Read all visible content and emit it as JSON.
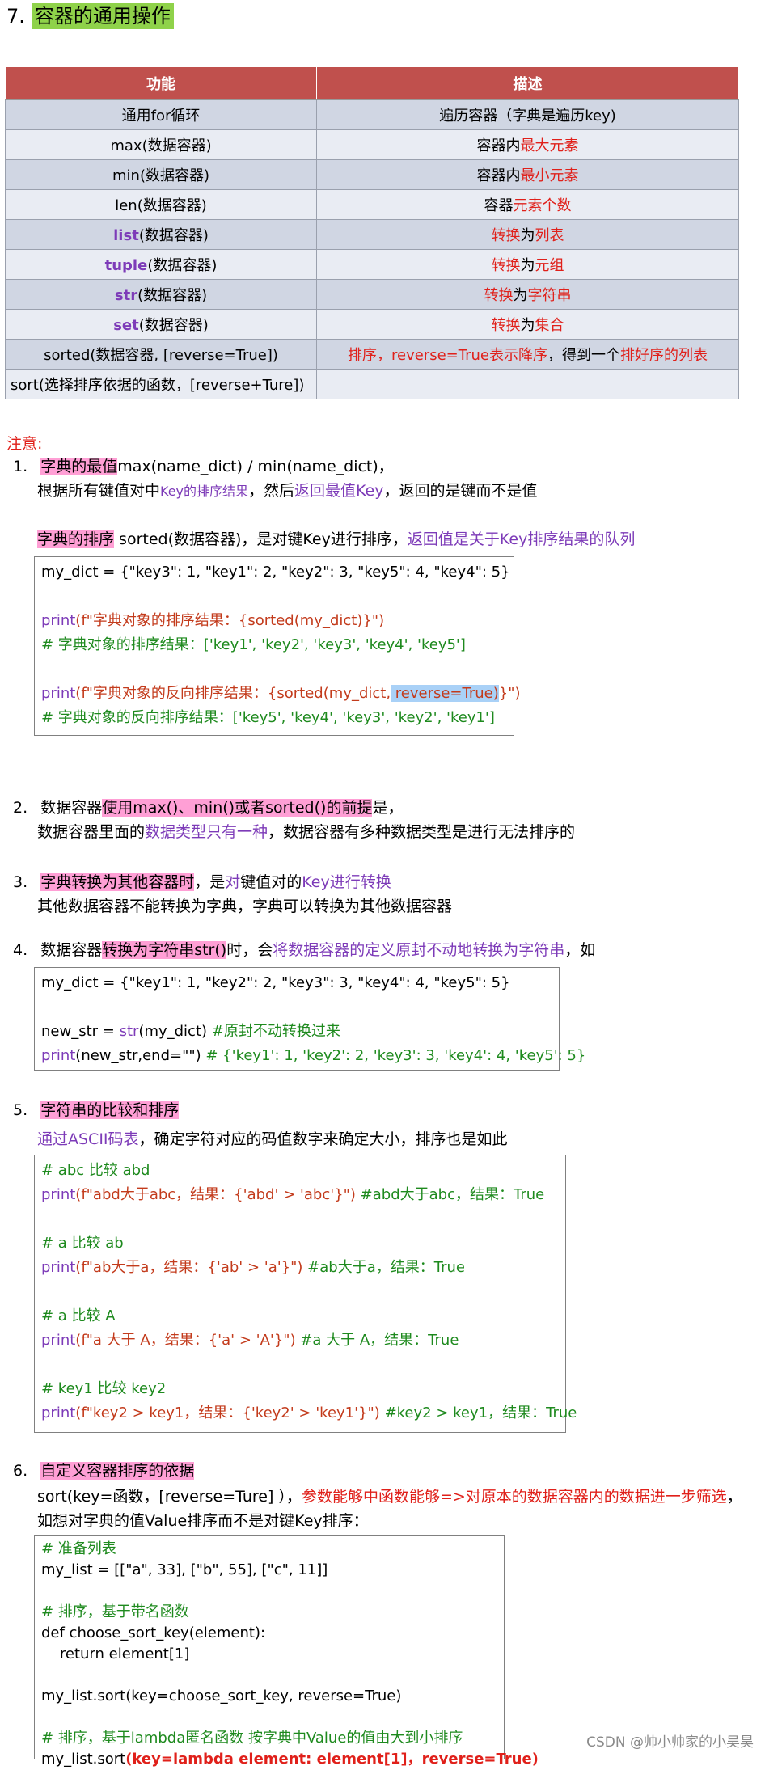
{
  "heading": {
    "number": "7.",
    "title": "容器的通用操作"
  },
  "table": {
    "headers": [
      "功能",
      "描述"
    ],
    "rows": [
      {
        "func": "通用for循环",
        "desc": "遍历容器（字典是遍历key)"
      },
      {
        "func": "max(数据容器)",
        "desc_a": "容器内",
        "desc_b": "最大元素"
      },
      {
        "func": "min(数据容器)",
        "desc_a": "容器内",
        "desc_b": "最小元素"
      },
      {
        "func": "len(数据容器)",
        "desc_a": "容器",
        "desc_b": "元素个数"
      },
      {
        "func_kw": "list",
        "func_rest": "(数据容器)",
        "desc_a": "转换",
        "desc_b": "为",
        "desc_c": "列表"
      },
      {
        "func_kw": "tuple",
        "func_rest": "(数据容器)",
        "desc_a": "转换",
        "desc_b": "为",
        "desc_c": "元组"
      },
      {
        "func_kw": "str",
        "func_rest": "(数据容器)",
        "desc_a": "转换",
        "desc_b": "为",
        "desc_c": "字符串"
      },
      {
        "func_kw": "set",
        "func_rest": "(数据容器)",
        "desc_a": "转换",
        "desc_b": "为",
        "desc_c": "集合"
      },
      {
        "func": "sorted(数据容器, [reverse=True])",
        "desc_a": "排序，reverse=True表示降序",
        "desc_b": "，得到一个",
        "desc_c": "排好序的列表"
      },
      {
        "func": "sort(选择排序依据的函数，[reverse+Ture])",
        "desc": ""
      }
    ]
  },
  "notes": {
    "label": "注意:",
    "n1": {
      "num": "1.",
      "hl": "字典的最值",
      "rest": "max(name_dict) / min(name_dict)，",
      "line2_a": "根据所有键值对中",
      "line2_b": "Key的排序结果",
      "line2_c": "，然后",
      "line2_d": "返回最值Key",
      "line2_e": "，返回的是键而不是值",
      "line3_hl": "字典的排序",
      "line3_a": " sorted(数据容器)，是对键Key进行排序，",
      "line3_b": "返回值是关于Key排序结果的队列",
      "code": {
        "l1": "my_dict = {\"key3\": 1, \"key1\": 2, \"key2\": 3, \"key5\": 4, \"key4\": 5}",
        "l2_kw": "print",
        "l2_rest": "(f\"字典对象的排序结果：{sorted(my_dict)}\")",
        "l3": "# 字典对象的排序结果：['key1', 'key2', 'key3', 'key4', 'key5']",
        "l4_kw": "print",
        "l4_a": "(f\"字典对象的反向排序结果：{sorted(my_dict,",
        "l4_hl": " reverse=True)",
        "l4_b": "}\")",
        "l5": "# 字典对象的反向排序结果：['key5', 'key4', 'key3', 'key2', 'key1']"
      }
    },
    "n2": {
      "num": "2.",
      "a": "数据容器",
      "hl": "使用max()、min()或者sorted()的前提",
      "b": "是，",
      "line2_a": "数据容器里面的",
      "line2_b": "数据类型只有一种",
      "line2_c": "，数据容器有多种数据类型是进行无法排序的"
    },
    "n3": {
      "num": "3.",
      "hl": "字典转换为其他容器时",
      "a": "，是",
      "b": "对",
      "c": "键值对的",
      "d": "Key进行转换",
      "line2": "其他数据容器不能转换为字典，字典可以转换为其他数据容器"
    },
    "n4": {
      "num": "4.",
      "a": "数据容器",
      "hl": "转换为字符串str()",
      "b": "时，会",
      "c": "将数据容器的定义原封不动地转换为字符串",
      "d": "，如",
      "code": {
        "l1": "my_dict = {\"key1\": 1, \"key2\": 2, \"key3\": 3, \"key4\": 4, \"key5\": 5}",
        "l2_a": "new_str = ",
        "l2_kw": "str",
        "l2_b": "(my_dict)   ",
        "l2_cm": "#原封不动转换过来",
        "l3_kw": "print",
        "l3_a": "(new_str,end=\"\")   ",
        "l3_cm": "# {'key1': 1, 'key2': 2, 'key3': 3, 'key4': 4, 'key5': 5}"
      }
    },
    "n5": {
      "num": "5.",
      "hl": "字符串的比较和排序",
      "line2_a": "通过ASCII码表",
      "line2_b": "，确定字符对应的码值数字来确定大小，排序也是如此",
      "code": {
        "c1": "# abc 比较 abd",
        "p1_kw": "print",
        "p1": "(f\"abd大于abc，结果：{'abd' > 'abc'}\")   ",
        "p1_cm": "#abd大于abc，结果：True",
        "c2": "# a 比较 ab",
        "p2_kw": "print",
        "p2": "(f\"ab大于a，结果：{'ab' > 'a'}\")   ",
        "p2_cm": "#ab大于a，结果：True",
        "c3": "# a 比较 A",
        "p3_kw": "print",
        "p3": "(f\"a 大于 A，结果：{'a' > 'A'}\")   ",
        "p3_cm": "#a 大于 A，结果：True",
        "c4": "# key1 比较 key2",
        "p4_kw": "print",
        "p4": "(f\"key2 > key1，结果：{'key2' > 'key1'}\")  ",
        "p4_cm": "#key2 > key1，结果：True"
      }
    },
    "n6": {
      "num": "6.",
      "hl": "自定义容器排序的依据",
      "line2_a": "sort(key=函数，[reverse=Ture] ），",
      "line2_b": "参数能够中函数能够=>对原本的数据容器内的数据进一步筛选",
      "line2_c": "，",
      "line3": "如想对字典的值Value排序而不是对键Key排序：",
      "code": {
        "l1": "# 准备列表",
        "l2": "my_list = [[\"a\", 33], [\"b\", 55], [\"c\", 11]]",
        "l3": "# 排序，基于带名函数",
        "l4": "def choose_sort_key(element):",
        "l5": "    return element[1]",
        "l6": "my_list.sort(key=choose_sort_key, reverse=True)",
        "l7": "# 排序，基于lambda匿名函数   按字典中Value的值由大到小排序",
        "l8_a": "my_list.sort",
        "l8_b": "(key=lambda element: element[1]，reverse=True)"
      }
    }
  },
  "watermark": "CSDN @帅小帅家的小吴昊"
}
